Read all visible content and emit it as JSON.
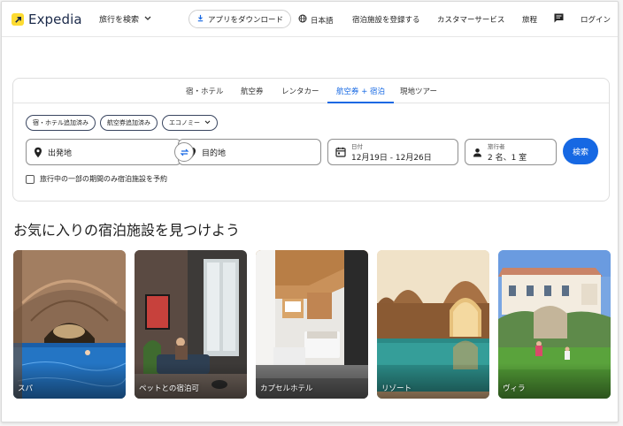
{
  "header": {
    "brand": "Expedia",
    "trip_search": "旅行を検索",
    "app_download": "アプリをダウンロード",
    "language": "日本語",
    "register_property": "宿泊施設を登録する",
    "customer_service": "カスタマーサービス",
    "trips": "旅程",
    "login": "ログイン"
  },
  "search": {
    "tabs": [
      {
        "label": "宿・ホテル"
      },
      {
        "label": "航空券"
      },
      {
        "label": "レンタカー"
      },
      {
        "label": "航空券 + 宿泊",
        "active": true
      },
      {
        "label": "現地ツアー"
      }
    ],
    "chips": [
      "宿・ホテル追加済み",
      "航空券追加済み",
      "エコノミー"
    ],
    "origin_placeholder": "出発地",
    "destination_placeholder": "目的地",
    "dates_label": "日付",
    "dates_value": "12月19日 - 12月26日",
    "travelers_label": "旅行者",
    "travelers_value": "2 名、1 室",
    "search_button": "検索",
    "partial_stay_checkbox": "旅行中の一部の期間のみ宿泊施設を予約"
  },
  "section": {
    "title": "お気に入りの宿泊施設を見つけよう",
    "cards": [
      "スパ",
      "ペットとの宿泊可",
      "カプセルホテル",
      "リゾート",
      "ヴィラ"
    ]
  },
  "colors": {
    "accent": "#1668e3",
    "brand_yellow": "#fddb32",
    "brand_navy": "#1b2a4a"
  }
}
